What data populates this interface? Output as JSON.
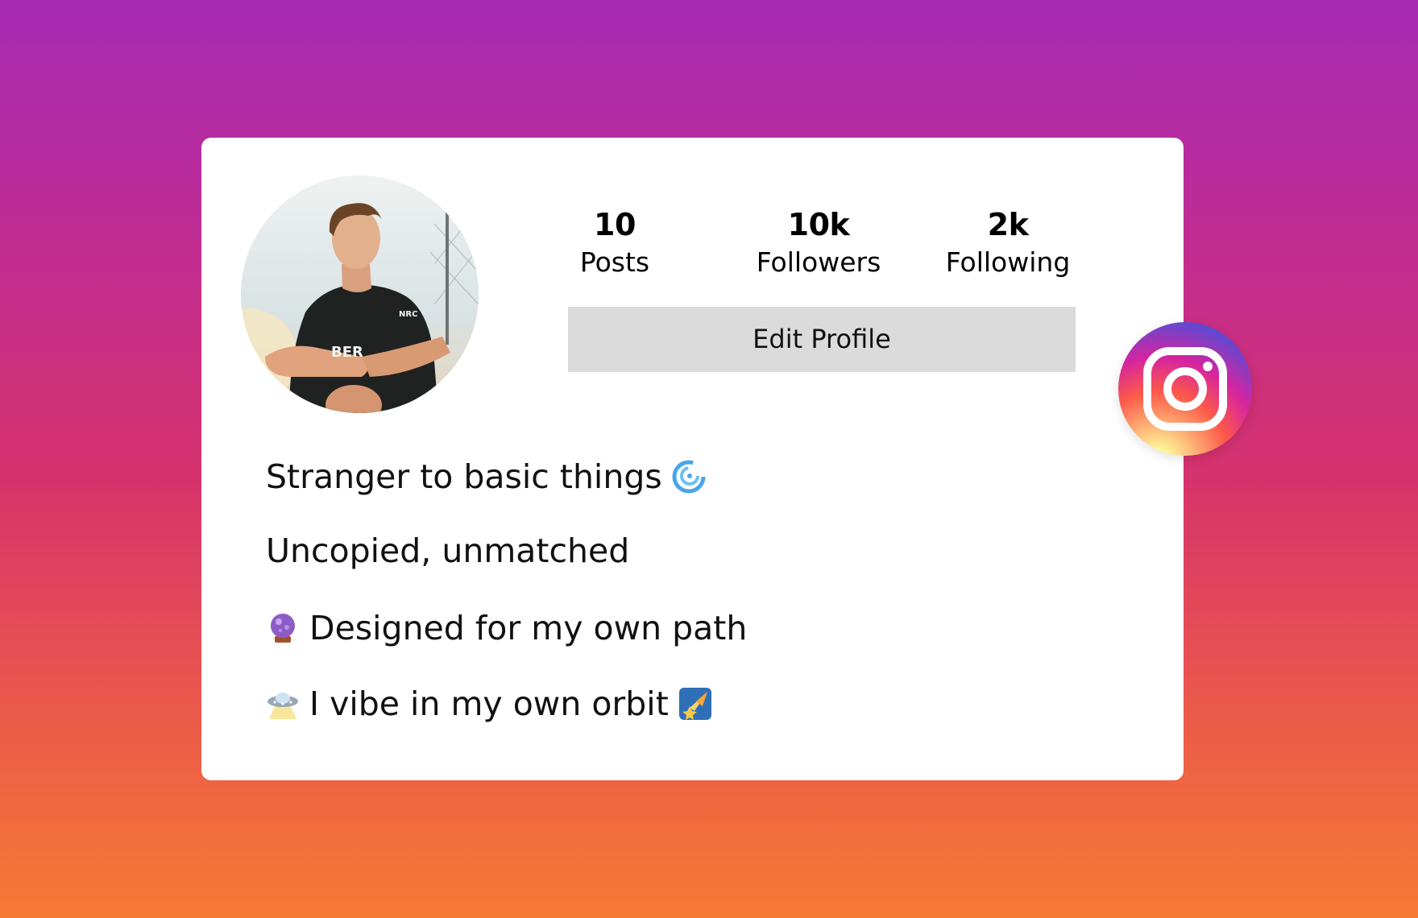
{
  "profile": {
    "avatar_alt": "profile photo",
    "stats": [
      {
        "value": "10",
        "label": "Posts"
      },
      {
        "value": "10k",
        "label": "Followers"
      },
      {
        "value": "2k",
        "label": "Following"
      }
    ],
    "edit_button_label": "Edit Profile"
  },
  "bio": {
    "lines": [
      {
        "text": "Stranger to basic things",
        "icon": "cyclone-emoji"
      },
      {
        "text": "Uncopied, unmatched",
        "icon": ""
      },
      {
        "text": "Designed for my own path",
        "icon": "crystal-ball-emoji"
      },
      {
        "text": "I vibe in my own orbit",
        "icon_before": "ufo-emoji",
        "icon_after": "shooting-star-emoji"
      }
    ]
  },
  "badge": {
    "icon": "instagram-logo-icon"
  },
  "colors": {
    "background_top": "#a62ab4",
    "background_bottom": "#f77a32",
    "card": "#ffffff",
    "button": "#dbdbdb"
  }
}
